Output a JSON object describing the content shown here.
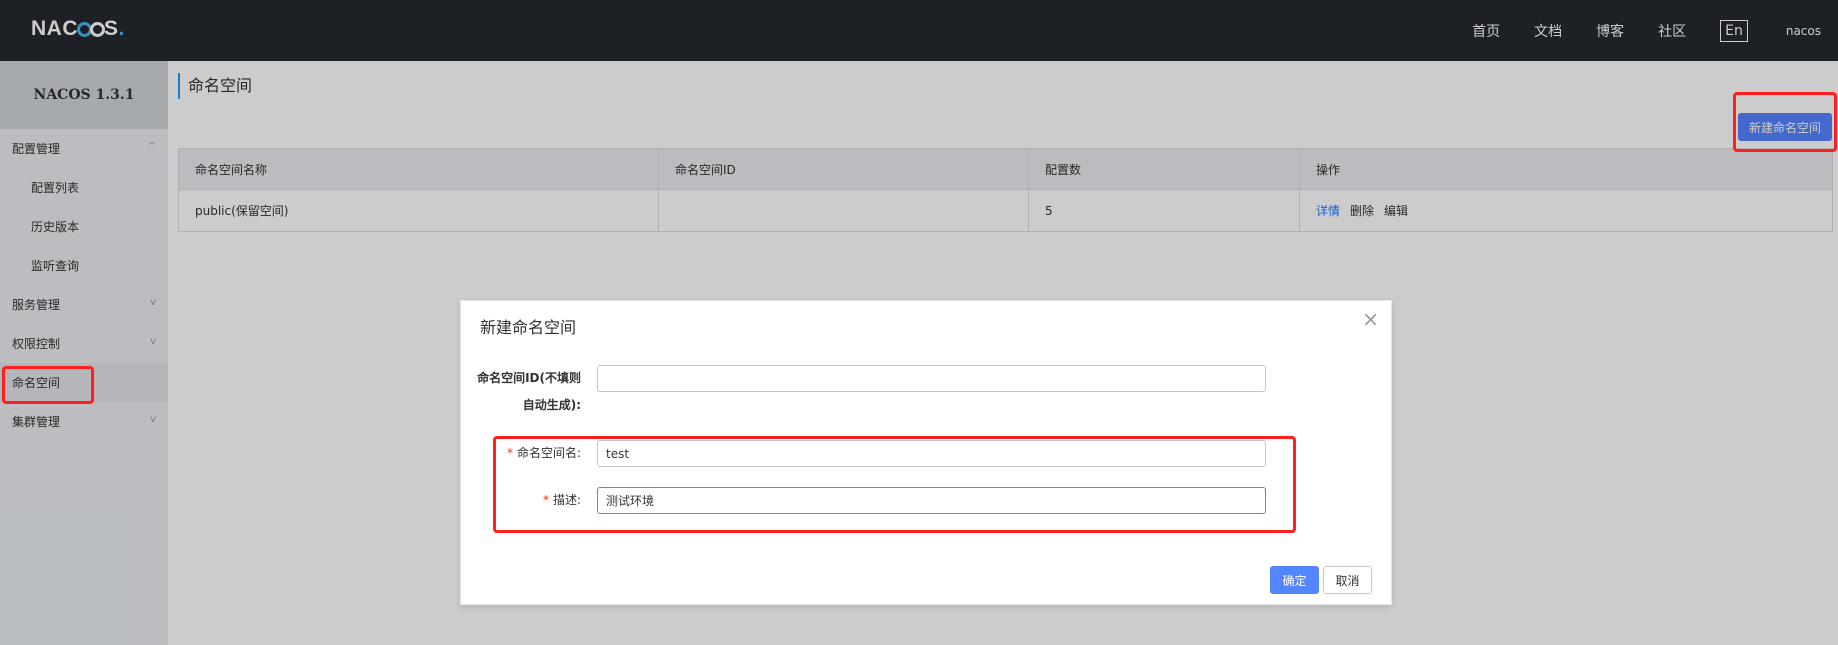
{
  "topbar": {
    "logo_parts": [
      "NAC",
      "S",
      "."
    ],
    "nav": [
      "首页",
      "文档",
      "博客",
      "社区"
    ],
    "lang": "En",
    "user": "nacos"
  },
  "sidebar": {
    "title": "NACOS 1.3.1",
    "items": [
      {
        "label": "配置管理",
        "arrow": "^"
      },
      {
        "label": "配置列表"
      },
      {
        "label": "历史版本"
      },
      {
        "label": "监听查询"
      },
      {
        "label": "服务管理",
        "arrow": "v"
      },
      {
        "label": "权限控制",
        "arrow": "v"
      },
      {
        "label": "命名空间"
      },
      {
        "label": "集群管理",
        "arrow": "v"
      }
    ]
  },
  "main": {
    "title": "命名空间",
    "new_button": "新建命名空间",
    "table": {
      "headers": [
        "命名空间名称",
        "命名空间ID",
        "配置数",
        "操作"
      ],
      "rows": [
        {
          "name": "public(保留空间)",
          "id": "",
          "count": "5",
          "actions": [
            "详情",
            "删除",
            "编辑"
          ]
        }
      ]
    }
  },
  "dialog": {
    "title": "新建命名空间",
    "close": "×",
    "id_label": "命名空间ID(不填则自动生成):",
    "id_value": "",
    "name_label": "命名空间名:",
    "name_value": "test",
    "desc_label": "描述:",
    "desc_value": "测试环境",
    "required_mark": "*",
    "ok": "确定",
    "cancel": "取消"
  },
  "colors": {
    "topbar": "#252a2f",
    "primary": "#5584ff",
    "annotation": "#ff1f1f",
    "link": "#2077ff"
  }
}
